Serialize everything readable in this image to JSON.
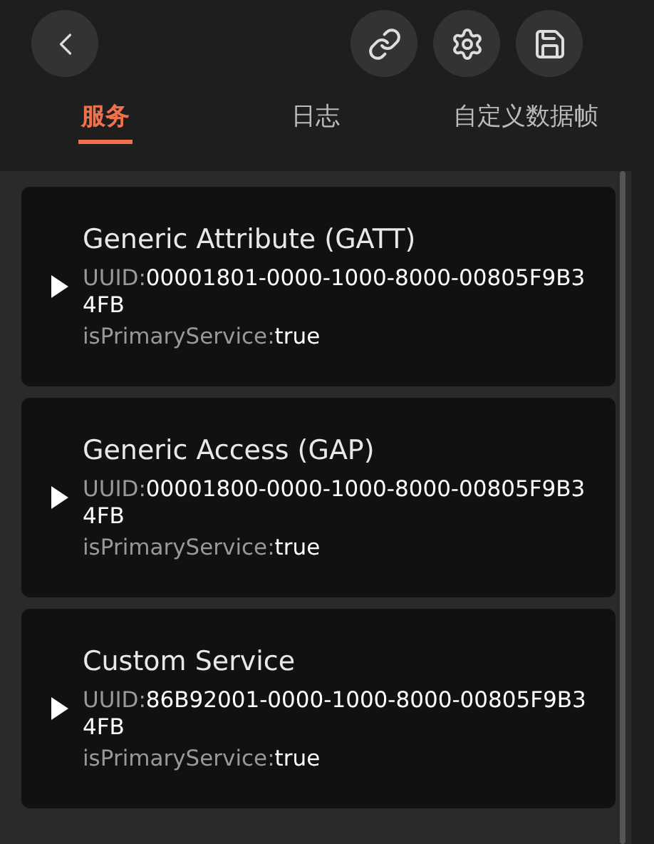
{
  "toolbar": {
    "actions": [
      {
        "kind": "link"
      },
      {
        "kind": "settings"
      },
      {
        "kind": "save"
      }
    ]
  },
  "tabs": [
    {
      "label": "服务",
      "selected": true
    },
    {
      "label": "日志",
      "selected": false
    },
    {
      "label": "自定义数据帧",
      "selected": false
    }
  ],
  "services": [
    {
      "name": "Generic Attribute (GATT)",
      "uuid_label": "UUID:",
      "uuid": "00001801-0000-1000-8000-00805F9B34FB",
      "primary_label": "isPrimaryService:",
      "primary": "true",
      "expanded": false
    },
    {
      "name": "Generic Access (GAP)",
      "uuid_label": "UUID:",
      "uuid": "00001800-0000-1000-8000-00805F9B34FB",
      "primary_label": "isPrimaryService:",
      "primary": "true",
      "expanded": false
    },
    {
      "name": "Custom Service",
      "uuid_label": "UUID:",
      "uuid": "86B92001-0000-1000-8000-00805F9B34FB",
      "primary_label": "isPrimaryService:",
      "primary": "true",
      "expanded": false
    }
  ]
}
